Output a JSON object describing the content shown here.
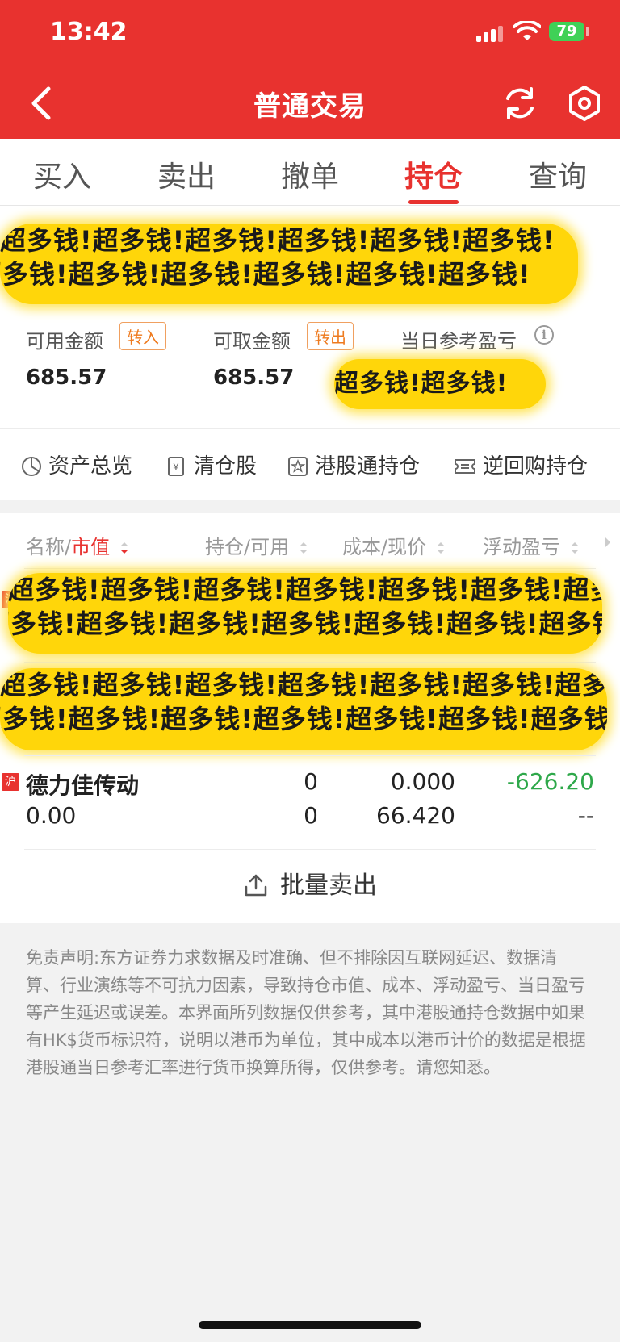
{
  "status_bar": {
    "time": "13:42",
    "battery": "79"
  },
  "nav": {
    "title": "普通交易"
  },
  "tabs": [
    "买入",
    "卖出",
    "撤单",
    "持仓",
    "查询"
  ],
  "account": {
    "hidden_labels_overlay": "超多钱!超多钱!超多钱!超多钱!超多钱!超多钱!",
    "available_label": "可用金额",
    "available_value": "685.57",
    "transfer_in": "转入",
    "withdrawable_label": "可取金额",
    "withdrawable_value": "685.57",
    "transfer_out": "转出",
    "daily_pnl_label": "当日参考盈亏",
    "daily_pnl_overlay": "超多钱!超多钱!"
  },
  "shortcuts": [
    "资产总览",
    "清仓股",
    "港股通持仓",
    "逆回购持仓"
  ],
  "table": {
    "headers": {
      "name_prefix": "名称/",
      "name_sort": "市值",
      "holding": "持仓/可用",
      "cost": "成本/现价",
      "pnl": "浮动盈亏"
    },
    "overlay_text": "超多钱!超多钱!超多钱!超多钱!超多钱!超多钱!超多钱!",
    "market_badge": "沪",
    "rows": [
      {
        "name": "德力佳传动",
        "market_value": "0.00",
        "holding": "0",
        "available": "0",
        "cost": "0.000",
        "price": "66.420",
        "pnl": "-626.20",
        "pnl_ratio": "--"
      }
    ]
  },
  "batch_sell": "批量卖出",
  "disclaimer": "免责声明:东方证券力求数据及时准确、但不排除因互联网延迟、数据清算、行业演练等不可抗力因素，导致持仓市值、成本、浮动盈亏、当日盈亏等产生延迟或误差。本界面所列数据仅供参考，其中港股通持仓数据中如果有HK$货币标识符，说明以港币为单位，其中成本以港币计价的数据是根据港股通当日参考汇率进行货币换算所得，仅供参考。请您知悉。",
  "colors": {
    "brand_red": "#e8322f",
    "profit_green": "#2ea84a",
    "accent_orange": "#ee7a1e",
    "highlight_yellow": "#ffd60a"
  }
}
